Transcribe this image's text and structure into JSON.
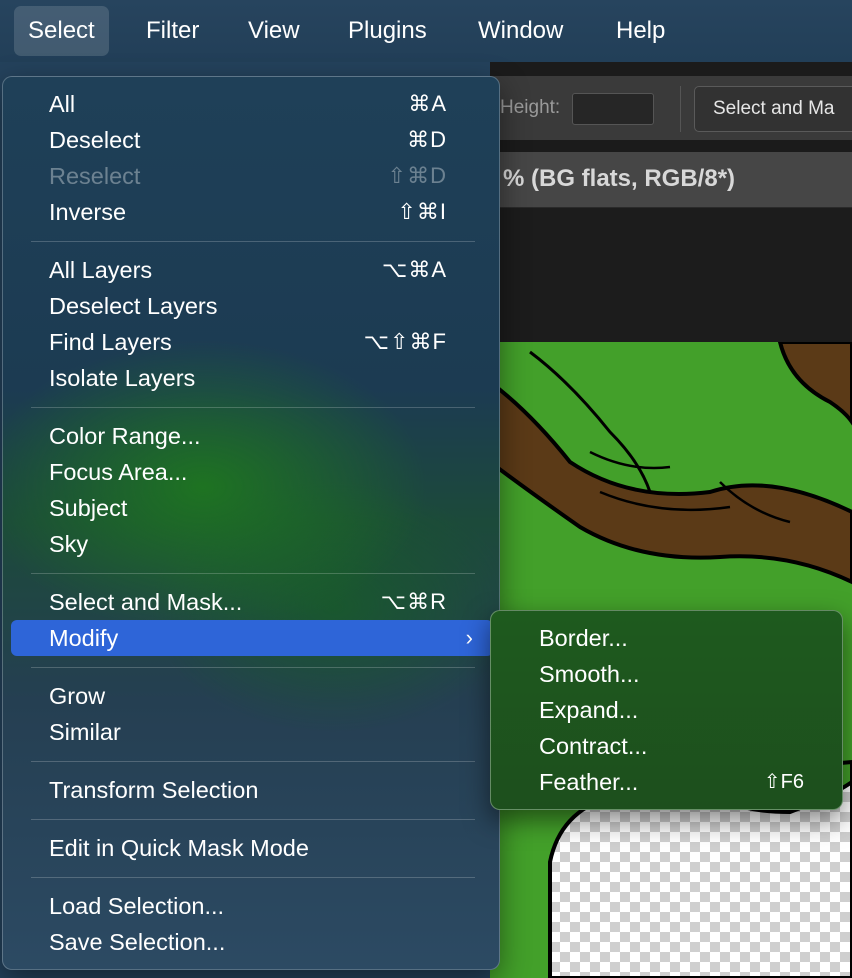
{
  "menubar": {
    "items": [
      "Select",
      "Filter",
      "View",
      "Plugins",
      "Window",
      "Help"
    ]
  },
  "options_bar": {
    "height_label": "Height:",
    "select_and_mask_button": "Select and Ma"
  },
  "document": {
    "tab_title": "% (BG flats, RGB/8*)"
  },
  "select_menu": {
    "items": [
      {
        "label": "All",
        "shortcut": "⌘A"
      },
      {
        "label": "Deselect",
        "shortcut": "⌘D"
      },
      {
        "label": "Reselect",
        "shortcut": "⇧⌘D",
        "disabled": true
      },
      {
        "label": "Inverse",
        "shortcut": "⇧⌘I"
      },
      {
        "label": "All Layers",
        "shortcut": "⌥⌘A"
      },
      {
        "label": "Deselect Layers",
        "shortcut": ""
      },
      {
        "label": "Find Layers",
        "shortcut": "⌥⇧⌘F"
      },
      {
        "label": "Isolate Layers",
        "shortcut": ""
      },
      {
        "label": "Color Range...",
        "shortcut": ""
      },
      {
        "label": "Focus Area...",
        "shortcut": ""
      },
      {
        "label": "Subject",
        "shortcut": ""
      },
      {
        "label": "Sky",
        "shortcut": ""
      },
      {
        "label": "Select and Mask...",
        "shortcut": "⌥⌘R"
      },
      {
        "label": "Modify",
        "submenu_arrow": "›",
        "highlighted": true
      },
      {
        "label": "Grow",
        "shortcut": ""
      },
      {
        "label": "Similar",
        "shortcut": ""
      },
      {
        "label": "Transform Selection",
        "shortcut": ""
      },
      {
        "label": "Edit in Quick Mask Mode",
        "shortcut": ""
      },
      {
        "label": "Load Selection...",
        "shortcut": ""
      },
      {
        "label": "Save Selection...",
        "shortcut": ""
      }
    ]
  },
  "modify_submenu": {
    "items": [
      {
        "label": "Border...",
        "shortcut": ""
      },
      {
        "label": "Smooth...",
        "shortcut": ""
      },
      {
        "label": "Expand...",
        "shortcut": ""
      },
      {
        "label": "Contract...",
        "shortcut": ""
      },
      {
        "label": "Feather...",
        "shortcut": "⇧F6"
      }
    ]
  },
  "colors": {
    "highlight": "#2e65d8",
    "canvas_green": "#43a02a",
    "branch_brown": "#5b3a17"
  }
}
